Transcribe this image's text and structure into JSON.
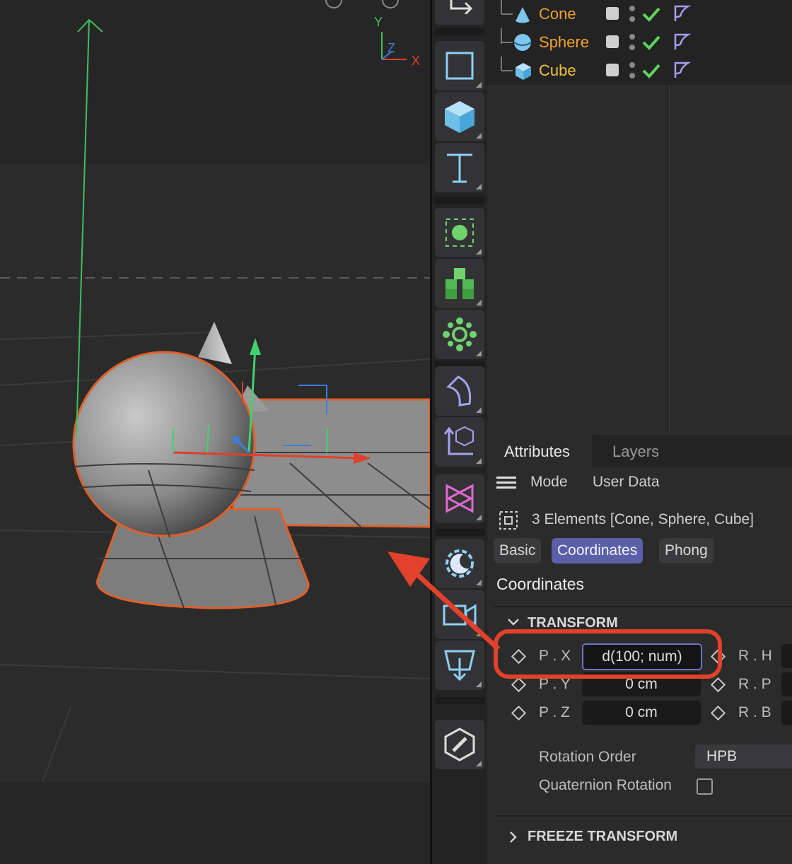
{
  "objects": [
    {
      "name": "Cone",
      "color": "#f0a030",
      "icon": "cone-icon"
    },
    {
      "name": "Sphere",
      "color": "#f0a030",
      "icon": "sphere-icon"
    },
    {
      "name": "Cube",
      "color": "#f0c040",
      "icon": "cube-icon"
    }
  ],
  "viewport": {
    "axes": {
      "y": "Y",
      "z": "Z",
      "x": "X"
    }
  },
  "attributes": {
    "tabs": {
      "attributes": "Attributes",
      "layers": "Layers"
    },
    "menu": {
      "mode": "Mode",
      "user_data": "User Data"
    },
    "selection": "3 Elements [Cone, Sphere, Cube]",
    "subtabs": {
      "basic": "Basic",
      "coordinates": "Coordinates",
      "phong": "Phong"
    },
    "section_title": "Coordinates",
    "transform_header": "TRANSFORM",
    "fields": {
      "px": {
        "label": "P . X",
        "value": "d(100; num)"
      },
      "py": {
        "label": "P . Y",
        "value": "0 cm"
      },
      "pz": {
        "label": "P . Z",
        "value": "0 cm"
      },
      "rh": {
        "label": "R . H"
      },
      "rp": {
        "label": "R . P"
      },
      "rb": {
        "label": "R . B"
      }
    },
    "rotation_order": {
      "label": "Rotation Order",
      "value": "HPB"
    },
    "quaternion_label": "Quaternion Rotation",
    "freeze_header": "FREEZE TRANSFORM"
  },
  "colors": {
    "accent": "#5a5fa8",
    "annotation": "#e2412b",
    "check": "#5fd35f"
  }
}
